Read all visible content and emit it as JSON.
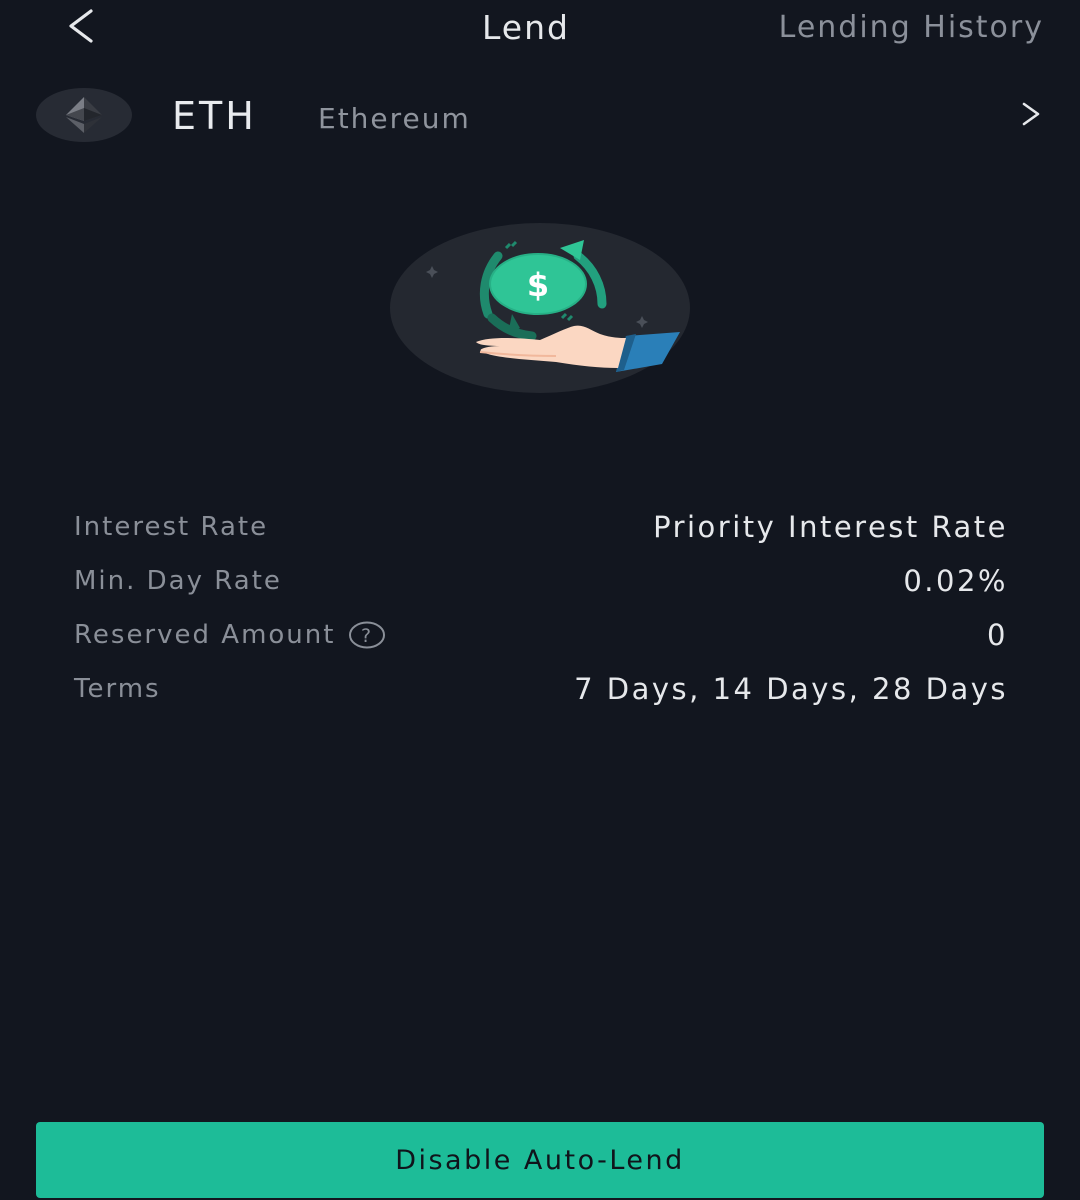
{
  "header": {
    "tabs": [
      {
        "label": "Lend",
        "active": true
      },
      {
        "label": "Lending History",
        "active": false
      }
    ]
  },
  "coin": {
    "symbol": "ETH",
    "name": "Ethereum",
    "icon": "ethereum-logo"
  },
  "info": {
    "rows": [
      {
        "label": "Interest Rate",
        "value": "Priority Interest Rate"
      },
      {
        "label": "Min. Day Rate",
        "value": "0.02%"
      },
      {
        "label": "Reserved Amount",
        "value": "0",
        "help_icon": "question-circle-icon"
      },
      {
        "label": "Terms",
        "value": "7 Days, 14 Days, 28 Days"
      }
    ]
  },
  "action": {
    "label": "Disable Auto-Lend"
  },
  "colors": {
    "background": "#12161f",
    "accent": "#1dbc98",
    "text_primary": "#e6e8eb",
    "text_secondary": "#8a8f98"
  }
}
